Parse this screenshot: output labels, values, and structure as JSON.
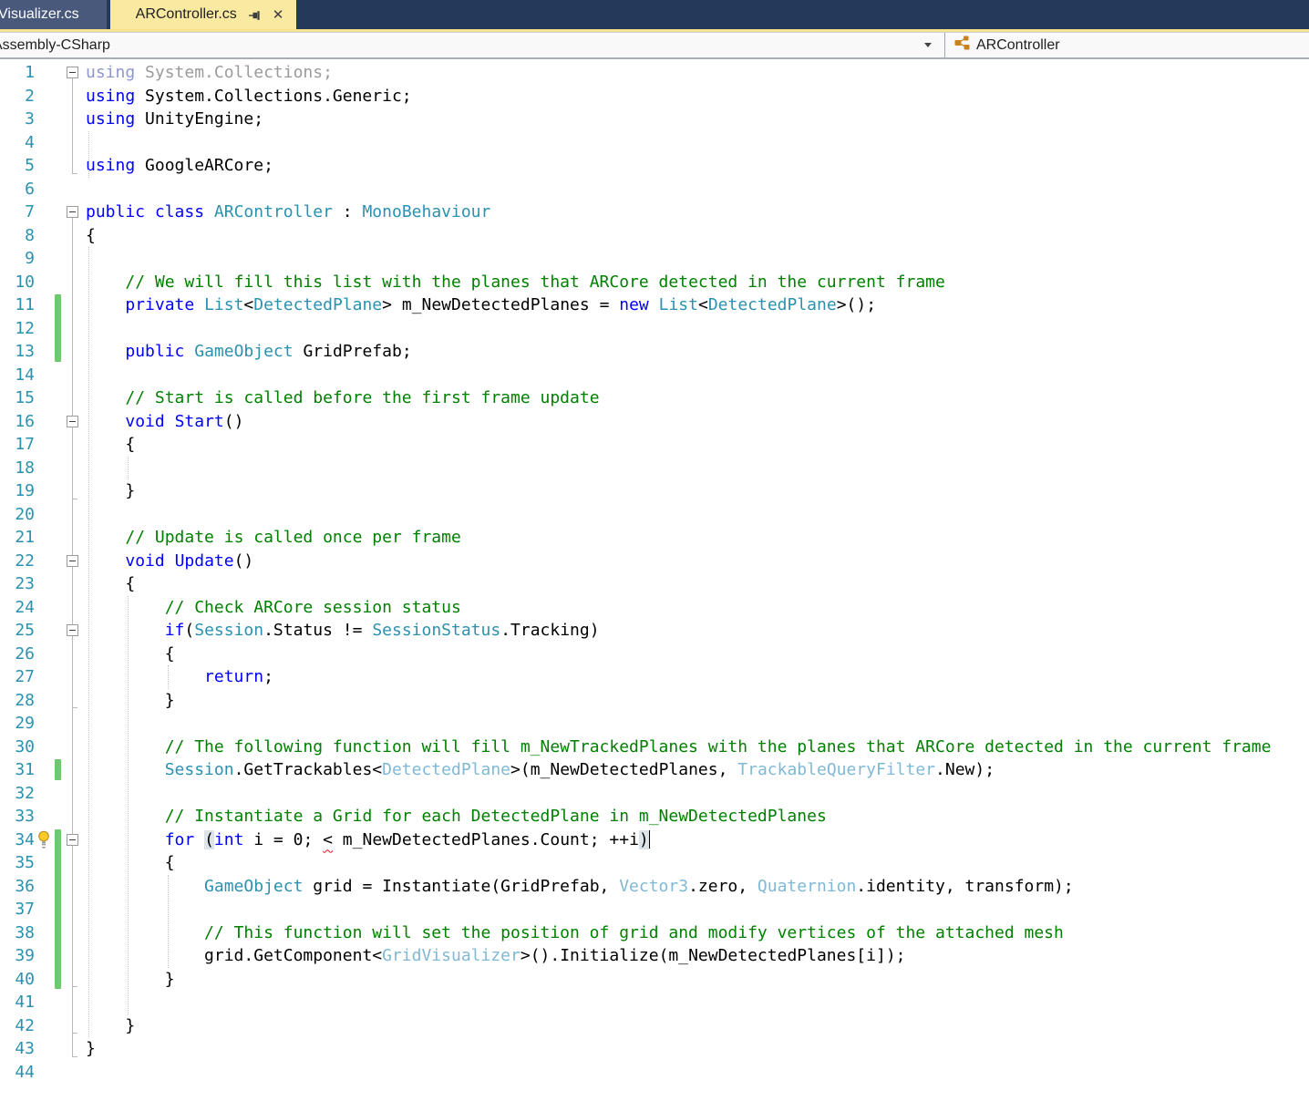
{
  "tabs": {
    "background_tab": "Visualizer.cs",
    "active_tab": "ARController.cs"
  },
  "icons": {
    "close": "✕"
  },
  "navbar": {
    "project": "Assembly-CSharp",
    "symbol": "ARController"
  },
  "colors": {
    "tabbar_bg": "#25395A",
    "inactive_tab_bg": "#48597B",
    "active_tab_bg": "#F9E9A1",
    "tab_underline": "#F6E38C",
    "keyword": "#0000FF",
    "comment": "#008000",
    "type": "#2B91AF",
    "type_light": "#7FB9D6",
    "grayed": "#9B9B9B",
    "line_number": "#2B91AF",
    "change_bar": "#6CC96C",
    "error_squiggle": "#E81123",
    "class_icon_orange": "#C8821E"
  },
  "gutter": {
    "change_bar_ranges": [
      [
        11,
        13
      ],
      [
        31,
        31
      ],
      [
        34,
        40
      ]
    ],
    "lightbulb_line": 34
  },
  "code": {
    "lines": [
      {
        "n": 1,
        "fold": true,
        "tokens": [
          {
            "s": "using",
            "c": "kg"
          },
          {
            "s": " System.Collections;",
            "c": "g"
          }
        ]
      },
      {
        "n": 2,
        "tokens": [
          {
            "s": "using",
            "c": "k"
          },
          {
            "s": " System.Collections.Generic;",
            "c": "p"
          }
        ]
      },
      {
        "n": 3,
        "tokens": [
          {
            "s": "using",
            "c": "k"
          },
          {
            "s": " UnityEngine;",
            "c": "p"
          }
        ]
      },
      {
        "n": 4,
        "tokens": []
      },
      {
        "n": 5,
        "tokens": [
          {
            "s": "using",
            "c": "k"
          },
          {
            "s": " GoogleARCore;",
            "c": "p"
          }
        ]
      },
      {
        "n": 6,
        "tokens": []
      },
      {
        "n": 7,
        "fold": true,
        "tokens": [
          {
            "s": "public",
            "c": "k"
          },
          {
            "s": " ",
            "c": "p"
          },
          {
            "s": "class",
            "c": "k"
          },
          {
            "s": " ",
            "c": "p"
          },
          {
            "s": "ARController",
            "c": "t"
          },
          {
            "s": " : ",
            "c": "p"
          },
          {
            "s": "MonoBehaviour",
            "c": "t"
          }
        ]
      },
      {
        "n": 8,
        "tokens": [
          {
            "s": "{",
            "c": "p"
          }
        ]
      },
      {
        "n": 9,
        "tokens": []
      },
      {
        "n": 10,
        "tokens": [
          {
            "s": "    ",
            "c": "p"
          },
          {
            "s": "// We will fill this list with the planes that ARCore detected in the current frame",
            "c": "c"
          }
        ]
      },
      {
        "n": 11,
        "tokens": [
          {
            "s": "    ",
            "c": "p"
          },
          {
            "s": "private",
            "c": "k"
          },
          {
            "s": " ",
            "c": "p"
          },
          {
            "s": "List",
            "c": "t"
          },
          {
            "s": "<",
            "c": "p"
          },
          {
            "s": "DetectedPlane",
            "c": "t"
          },
          {
            "s": "> m_NewDetectedPlanes = ",
            "c": "p"
          },
          {
            "s": "new",
            "c": "k"
          },
          {
            "s": " ",
            "c": "p"
          },
          {
            "s": "List",
            "c": "t"
          },
          {
            "s": "<",
            "c": "p"
          },
          {
            "s": "DetectedPlane",
            "c": "t"
          },
          {
            "s": ">();",
            "c": "p"
          }
        ]
      },
      {
        "n": 12,
        "tokens": []
      },
      {
        "n": 13,
        "tokens": [
          {
            "s": "    ",
            "c": "p"
          },
          {
            "s": "public",
            "c": "k"
          },
          {
            "s": " ",
            "c": "p"
          },
          {
            "s": "GameObject",
            "c": "t"
          },
          {
            "s": " GridPrefab;",
            "c": "p"
          }
        ]
      },
      {
        "n": 14,
        "tokens": []
      },
      {
        "n": 15,
        "tokens": [
          {
            "s": "    ",
            "c": "p"
          },
          {
            "s": "// Start is called before the first frame update",
            "c": "c"
          }
        ]
      },
      {
        "n": 16,
        "fold": true,
        "tokens": [
          {
            "s": "    ",
            "c": "p"
          },
          {
            "s": "void",
            "c": "k"
          },
          {
            "s": " ",
            "c": "p"
          },
          {
            "s": "Start",
            "c": "k"
          },
          {
            "s": "()",
            "c": "p"
          }
        ]
      },
      {
        "n": 17,
        "tokens": [
          {
            "s": "    {",
            "c": "p"
          }
        ]
      },
      {
        "n": 18,
        "tokens": []
      },
      {
        "n": 19,
        "tokens": [
          {
            "s": "    }",
            "c": "p"
          }
        ]
      },
      {
        "n": 20,
        "tokens": []
      },
      {
        "n": 21,
        "tokens": [
          {
            "s": "    ",
            "c": "p"
          },
          {
            "s": "// Update is called once per frame",
            "c": "c"
          }
        ]
      },
      {
        "n": 22,
        "fold": true,
        "tokens": [
          {
            "s": "    ",
            "c": "p"
          },
          {
            "s": "void",
            "c": "k"
          },
          {
            "s": " ",
            "c": "p"
          },
          {
            "s": "Update",
            "c": "k"
          },
          {
            "s": "()",
            "c": "p"
          }
        ]
      },
      {
        "n": 23,
        "tokens": [
          {
            "s": "    {",
            "c": "p"
          }
        ]
      },
      {
        "n": 24,
        "tokens": [
          {
            "s": "        ",
            "c": "p"
          },
          {
            "s": "// Check ARCore session status",
            "c": "c"
          }
        ]
      },
      {
        "n": 25,
        "fold": true,
        "tokens": [
          {
            "s": "        ",
            "c": "p"
          },
          {
            "s": "if",
            "c": "k"
          },
          {
            "s": "(",
            "c": "p"
          },
          {
            "s": "Session",
            "c": "t"
          },
          {
            "s": ".Status != ",
            "c": "p"
          },
          {
            "s": "SessionStatus",
            "c": "t"
          },
          {
            "s": ".Tracking)",
            "c": "p"
          }
        ]
      },
      {
        "n": 26,
        "tokens": [
          {
            "s": "        {",
            "c": "p"
          }
        ]
      },
      {
        "n": 27,
        "tokens": [
          {
            "s": "            ",
            "c": "p"
          },
          {
            "s": "return",
            "c": "k"
          },
          {
            "s": ";",
            "c": "p"
          }
        ]
      },
      {
        "n": 28,
        "tokens": [
          {
            "s": "        }",
            "c": "p"
          }
        ]
      },
      {
        "n": 29,
        "tokens": []
      },
      {
        "n": 30,
        "tokens": [
          {
            "s": "        ",
            "c": "p"
          },
          {
            "s": "// The following function will fill m_NewTrackedPlanes with the planes that ARCore detected in the current frame",
            "c": "c"
          }
        ]
      },
      {
        "n": 31,
        "tokens": [
          {
            "s": "        ",
            "c": "p"
          },
          {
            "s": "Session",
            "c": "t"
          },
          {
            "s": ".GetTrackables",
            "c": "p"
          },
          {
            "s": "<",
            "c": "p"
          },
          {
            "s": "DetectedPlane",
            "c": "tl"
          },
          {
            "s": ">",
            "c": "p"
          },
          {
            "s": "(m_NewDetectedPlanes, ",
            "c": "p"
          },
          {
            "s": "TrackableQueryFilter",
            "c": "tl"
          },
          {
            "s": ".New);",
            "c": "p"
          }
        ]
      },
      {
        "n": 32,
        "tokens": []
      },
      {
        "n": 33,
        "tokens": [
          {
            "s": "        ",
            "c": "p"
          },
          {
            "s": "// Instantiate a Grid for each DetectedPlane in m_NewDetectedPlanes",
            "c": "c"
          }
        ]
      },
      {
        "n": 34,
        "fold": true,
        "caret": true,
        "tokens": [
          {
            "s": "        ",
            "c": "p"
          },
          {
            "s": "for",
            "c": "k"
          },
          {
            "s": " ",
            "c": "p"
          },
          {
            "s": "(",
            "c": "hl"
          },
          {
            "s": "int",
            "c": "k"
          },
          {
            "s": " i = 0; ",
            "c": "p"
          },
          {
            "s": "<",
            "c": "err"
          },
          {
            "s": " m_NewDetectedPlanes.Count; ++i",
            "c": "p"
          },
          {
            "s": ")",
            "c": "hl"
          }
        ]
      },
      {
        "n": 35,
        "tokens": [
          {
            "s": "        {",
            "c": "p"
          }
        ]
      },
      {
        "n": 36,
        "tokens": [
          {
            "s": "            ",
            "c": "p"
          },
          {
            "s": "GameObject",
            "c": "t"
          },
          {
            "s": " grid = Instantiate(GridPrefab, ",
            "c": "p"
          },
          {
            "s": "Vector3",
            "c": "tl"
          },
          {
            "s": ".zero, ",
            "c": "p"
          },
          {
            "s": "Quaternion",
            "c": "tl"
          },
          {
            "s": ".identity, transform);",
            "c": "p"
          }
        ]
      },
      {
        "n": 37,
        "tokens": []
      },
      {
        "n": 38,
        "tokens": [
          {
            "s": "            ",
            "c": "p"
          },
          {
            "s": "// This function will set the position of grid and modify vertices of the attached mesh",
            "c": "c"
          }
        ]
      },
      {
        "n": 39,
        "tokens": [
          {
            "s": "            ",
            "c": "p"
          },
          {
            "s": "grid.GetComponent",
            "c": "p"
          },
          {
            "s": "<",
            "c": "p"
          },
          {
            "s": "GridVisualizer",
            "c": "tl"
          },
          {
            "s": ">",
            "c": "p"
          },
          {
            "s": "().Initialize(m_NewDetectedPlanes[i]);",
            "c": "p"
          }
        ]
      },
      {
        "n": 40,
        "tokens": [
          {
            "s": "        }",
            "c": "p"
          }
        ]
      },
      {
        "n": 41,
        "tokens": []
      },
      {
        "n": 42,
        "tokens": [
          {
            "s": "    }",
            "c": "p"
          }
        ]
      },
      {
        "n": 43,
        "tokens": [
          {
            "s": "}",
            "c": "p"
          }
        ]
      },
      {
        "n": 44,
        "tokens": []
      }
    ]
  }
}
